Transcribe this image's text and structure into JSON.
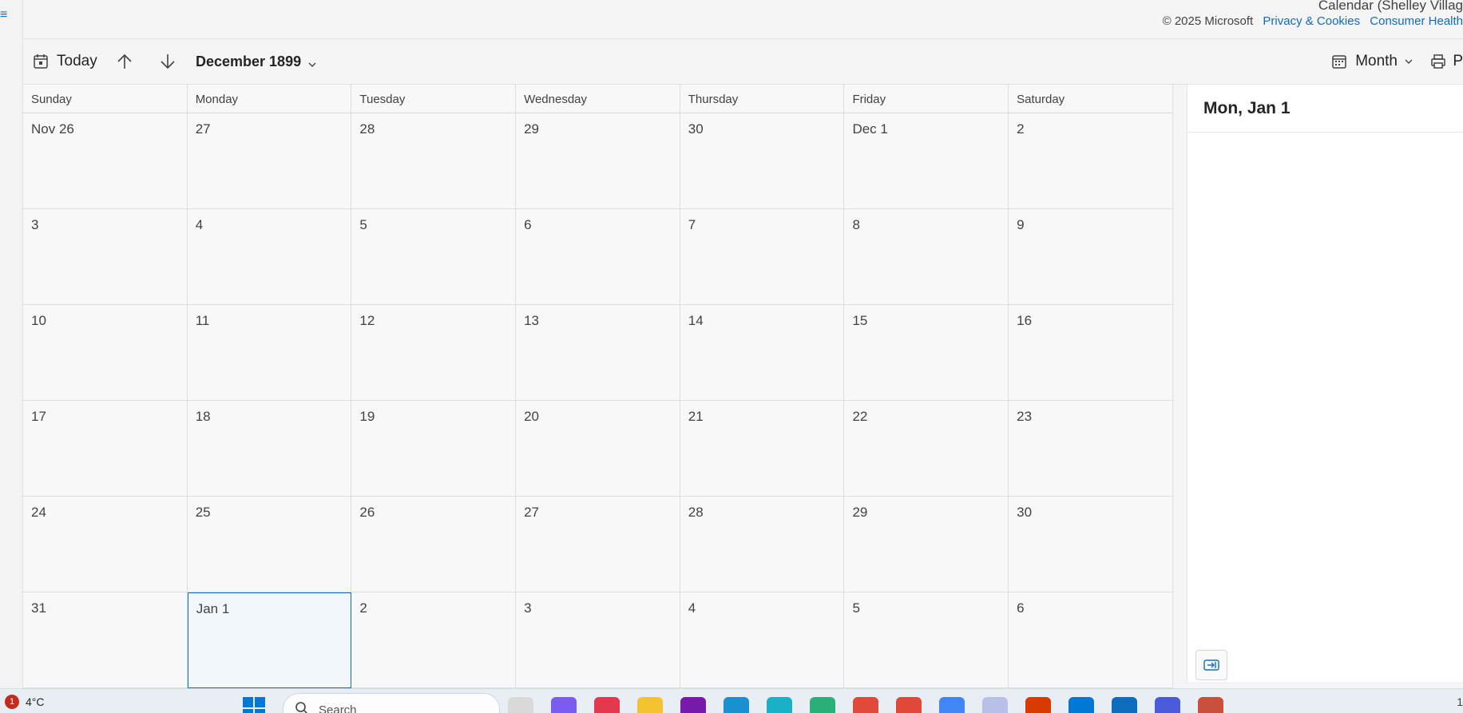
{
  "header": {
    "calendar_name": "Calendar (Shelley Villag",
    "copyright": "© 2025 Microsoft",
    "privacy_link": "Privacy & Cookies",
    "consumer_link": "Consumer Health"
  },
  "toolbar": {
    "today_label": "Today",
    "month_label": "December 1899",
    "view_label": "Month",
    "print_label": "P"
  },
  "weekdays": [
    "Sunday",
    "Monday",
    "Tuesday",
    "Wednesday",
    "Thursday",
    "Friday",
    "Saturday"
  ],
  "weeks": [
    [
      "Nov 26",
      "27",
      "28",
      "29",
      "30",
      "Dec 1",
      "2"
    ],
    [
      "3",
      "4",
      "5",
      "6",
      "7",
      "8",
      "9"
    ],
    [
      "10",
      "11",
      "12",
      "13",
      "14",
      "15",
      "16"
    ],
    [
      "17",
      "18",
      "19",
      "20",
      "21",
      "22",
      "23"
    ],
    [
      "24",
      "25",
      "26",
      "27",
      "28",
      "29",
      "30"
    ],
    [
      "31",
      "Jan 1",
      "2",
      "3",
      "4",
      "5",
      "6"
    ]
  ],
  "selected_day": "Jan 1",
  "side_panel": {
    "title": "Mon, Jan 1"
  },
  "taskbar": {
    "notification_count": "1",
    "temperature": "4°C",
    "search_placeholder": "Search",
    "tray_text": "1"
  },
  "colors": {
    "accent": "#0f6cbd",
    "selected_bg": "#f2f7fc",
    "badge": "#c42b1c"
  }
}
